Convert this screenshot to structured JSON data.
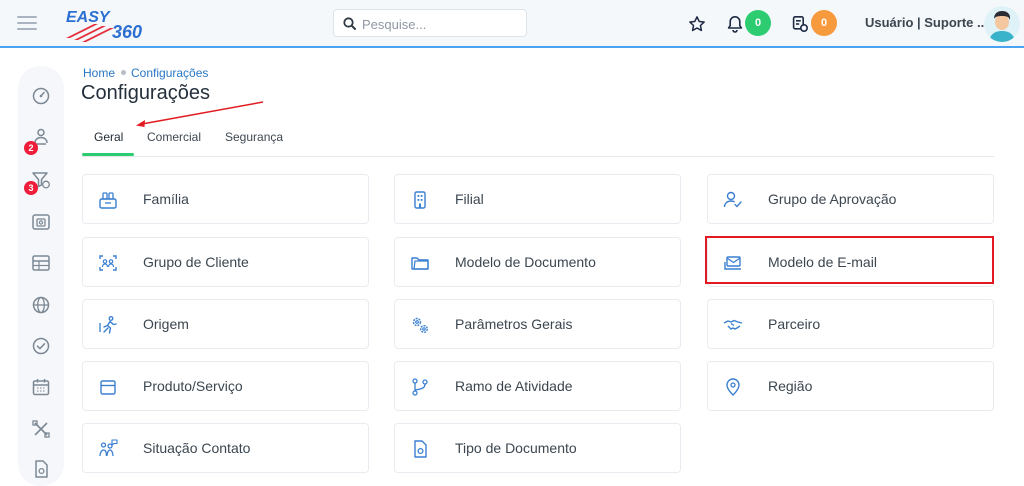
{
  "app": {
    "logo_text": "EASY 360",
    "search_placeholder": "Pesquise...",
    "notifications_count": "0",
    "tasks_count": "0",
    "user_name": "Usuário | Suporte ...",
    "colors": {
      "accent_blue": "#2877c3",
      "tab_green": "#2ecc71",
      "badge_green": "#2ecc71",
      "badge_orange": "#f79a3e",
      "badge_red": "#ee1d3a",
      "highlight_red": "#e21b22"
    }
  },
  "sidebar": {
    "items": [
      {
        "icon": "speedometer-icon"
      },
      {
        "icon": "users-icon",
        "badge": "2"
      },
      {
        "icon": "filter-dollar-icon",
        "badge": "3"
      },
      {
        "icon": "camera-box-icon"
      },
      {
        "icon": "table-icon"
      },
      {
        "icon": "globe-icon"
      },
      {
        "icon": "check-circle-icon"
      },
      {
        "icon": "calendar-icon"
      },
      {
        "icon": "tools-icon"
      },
      {
        "icon": "document-icon"
      }
    ]
  },
  "breadcrumb": {
    "home": "Home",
    "current": "Configurações"
  },
  "page": {
    "title": "Configurações"
  },
  "tabs": [
    {
      "label": "Geral",
      "active": true
    },
    {
      "label": "Comercial",
      "active": false
    },
    {
      "label": "Segurança",
      "active": false
    }
  ],
  "cards": [
    {
      "label": "Família",
      "icon": "family-box-icon"
    },
    {
      "label": "Filial",
      "icon": "building-icon"
    },
    {
      "label": "Grupo de Aprovação",
      "icon": "user-check-icon"
    },
    {
      "label": "Grupo de Cliente",
      "icon": "group-scan-icon"
    },
    {
      "label": "Modelo de Documento",
      "icon": "folder-icon"
    },
    {
      "label": "Modelo de E-mail",
      "icon": "email-tray-icon"
    },
    {
      "label": "Origem",
      "icon": "runner-icon"
    },
    {
      "label": "Parâmetros Gerais",
      "icon": "gears-icon"
    },
    {
      "label": "Parceiro",
      "icon": "handshake-icon"
    },
    {
      "label": "Produto/Serviço",
      "icon": "box-icon"
    },
    {
      "label": "Ramo de Atividade",
      "icon": "branch-icon"
    },
    {
      "label": "Região",
      "icon": "map-pin-icon"
    },
    {
      "label": "Situação Contato",
      "icon": "people-chat-icon"
    },
    {
      "label": "Tipo de Documento",
      "icon": "document-pin-icon"
    }
  ]
}
